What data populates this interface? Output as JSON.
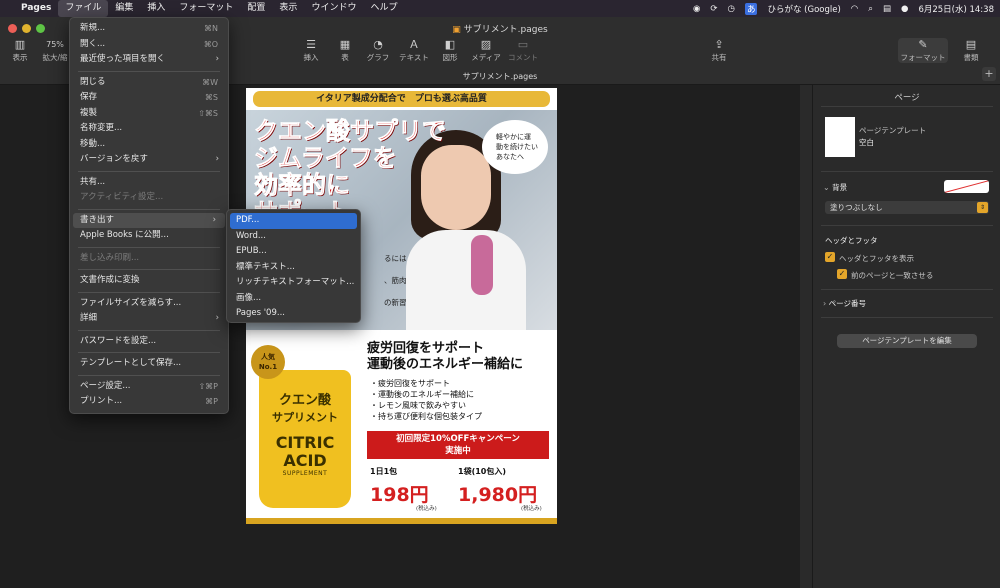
{
  "menubar": {
    "app": "Pages",
    "items": [
      "ファイル",
      "編集",
      "挿入",
      "フォーマット",
      "配置",
      "表示",
      "ウインドウ",
      "ヘルプ"
    ],
    "input_method": "ひらがな (Google)",
    "ime_char": "あ",
    "datetime": "6月25日(水) 14:38"
  },
  "window": {
    "title": "サブリメント.pages",
    "subtitle": "サプリメント.pages",
    "zoom": "75%",
    "toolbar": {
      "view": "表示",
      "zoom_label": "拡大/縮",
      "insert": "挿入",
      "table": "表",
      "chart": "グラフ",
      "text": "テキスト",
      "shape": "図形",
      "media": "メディア",
      "comment": "コメント",
      "share": "共有",
      "format": "フォーマット",
      "document": "書類"
    }
  },
  "file_menu": {
    "new": "新規...",
    "new_sc": "⌘N",
    "open": "開く...",
    "open_sc": "⌘O",
    "recent": "最近使った項目を開く",
    "close": "閉じる",
    "close_sc": "⌘W",
    "save": "保存",
    "save_sc": "⌘S",
    "duplicate": "複製",
    "duplicate_sc": "⇧⌘S",
    "rename": "名称変更...",
    "move": "移動...",
    "revert": "バージョンを戻す",
    "share": "共有...",
    "activity": "アクティビティ設定...",
    "export": "書き出す",
    "apple_books": "Apple Books に公開...",
    "mail_merge": "差し込み印刷...",
    "convert": "文書作成に変換",
    "reduce": "ファイルサイズを減らす...",
    "advanced": "詳細",
    "password": "パスワードを設定...",
    "save_template": "テンプレートとして保存...",
    "page_setup": "ページ設定...",
    "page_setup_sc": "⇧⌘P",
    "print": "プリント...",
    "print_sc": "⌘P"
  },
  "export_menu": [
    "PDF...",
    "Word...",
    "EPUB...",
    "標準テキスト...",
    "リッチテキストフォーマット...",
    "画像...",
    "Pages '09..."
  ],
  "document": {
    "topbar": "イタリア製成分配合で　プロも選ぶ高品質",
    "headline": [
      "クエン酸サプリで",
      "ジムライフを",
      "効率的に",
      "サポート"
    ],
    "bubble": [
      "軽やかに運",
      "動を続けたい",
      "あなたへ"
    ],
    "hero_text": [
      "るには",
      "、筋肉",
      "の新習"
    ],
    "badge": [
      "人気",
      "No.1"
    ],
    "pouch_jp": [
      "クエン酸",
      "サプリメント"
    ],
    "pouch_en": [
      "CITRIC",
      "ACID"
    ],
    "pouch_sup": "SUPPLEMENT",
    "feature_title": [
      "疲労回復をサポート",
      "運動後のエネルギー補給に"
    ],
    "features": [
      "・疲労回復をサポート",
      "・運動後のエネルギー補給に",
      "・レモン風味で飲みやすい",
      "・持ち運び便利な個包装タイプ"
    ],
    "campaign": [
      "初回限定10%OFFキャンペーン",
      "実施中"
    ],
    "price1_label": "1日1包",
    "price1": "198円",
    "price2_label": "1袋(10包入)",
    "price2": "1,980円",
    "tax": "(税込み)"
  },
  "panel": {
    "title": "ページ",
    "template_label": "ページテンプレート",
    "template_value": "空白",
    "background": "背景",
    "fill": "塗りつぶしなし",
    "header_footer": "ヘッダとフッタ",
    "show_hf": "ヘッダとフッタを表示",
    "match_prev": "前のページと一致させる",
    "page_number": "ページ番号",
    "edit_template": "ページテンプレートを編集"
  },
  "colors": {
    "accent": "#2f6dd0",
    "checkbox": "#e3a52a",
    "price_red": "#d42020"
  }
}
